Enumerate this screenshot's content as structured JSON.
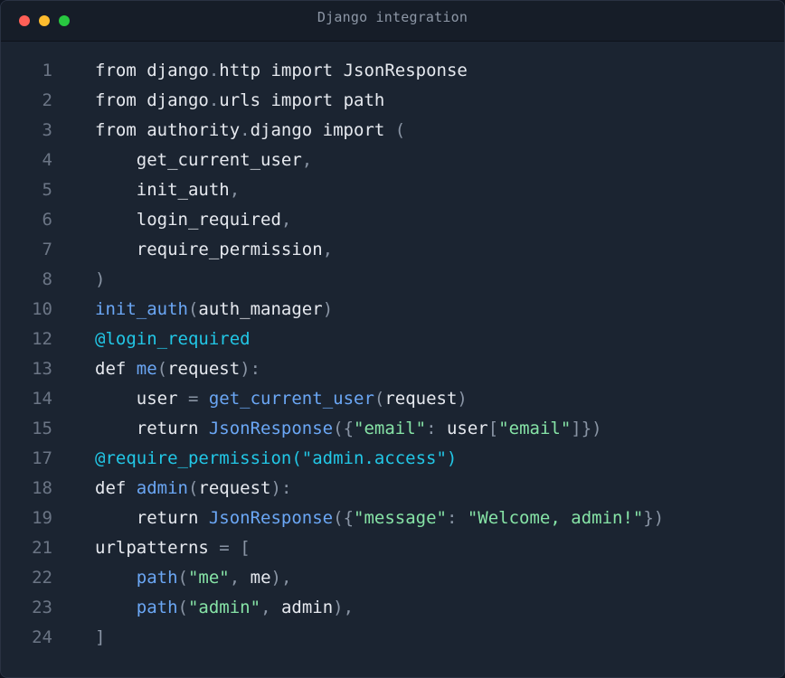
{
  "window": {
    "title": "Django integration"
  },
  "colors": {
    "background": "#1b2431",
    "titlebar": "#161d28",
    "plain": "#e6e9ef",
    "punct": "#8a95a5",
    "func": "#6ba7f5",
    "decorator": "#22c7e6",
    "string": "#86e3a6",
    "line_number": "#6b7585"
  },
  "code": {
    "lines": [
      {
        "n": "1",
        "tokens": [
          {
            "t": "from django",
            "c": "plain"
          },
          {
            "t": ".",
            "c": "punct"
          },
          {
            "t": "http import JsonResponse",
            "c": "plain"
          }
        ]
      },
      {
        "n": "2",
        "tokens": [
          {
            "t": "from django",
            "c": "plain"
          },
          {
            "t": ".",
            "c": "punct"
          },
          {
            "t": "urls import path",
            "c": "plain"
          }
        ]
      },
      {
        "n": "3",
        "tokens": [
          {
            "t": "from authority",
            "c": "plain"
          },
          {
            "t": ".",
            "c": "punct"
          },
          {
            "t": "django import ",
            "c": "plain"
          },
          {
            "t": "(",
            "c": "punct"
          }
        ]
      },
      {
        "n": "4",
        "tokens": [
          {
            "t": "    get_current_user",
            "c": "plain"
          },
          {
            "t": ",",
            "c": "punct"
          }
        ]
      },
      {
        "n": "5",
        "tokens": [
          {
            "t": "    init_auth",
            "c": "plain"
          },
          {
            "t": ",",
            "c": "punct"
          }
        ]
      },
      {
        "n": "6",
        "tokens": [
          {
            "t": "    login_required",
            "c": "plain"
          },
          {
            "t": ",",
            "c": "punct"
          }
        ]
      },
      {
        "n": "7",
        "tokens": [
          {
            "t": "    require_permission",
            "c": "plain"
          },
          {
            "t": ",",
            "c": "punct"
          }
        ]
      },
      {
        "n": "8",
        "tokens": [
          {
            "t": ")",
            "c": "punct"
          }
        ]
      },
      {
        "n": "10",
        "tokens": [
          {
            "t": "init_auth",
            "c": "func"
          },
          {
            "t": "(",
            "c": "punct"
          },
          {
            "t": "auth_manager",
            "c": "plain"
          },
          {
            "t": ")",
            "c": "punct"
          }
        ]
      },
      {
        "n": "12",
        "tokens": [
          {
            "t": "@login_required",
            "c": "deco"
          }
        ]
      },
      {
        "n": "13",
        "tokens": [
          {
            "t": "def ",
            "c": "plain"
          },
          {
            "t": "me",
            "c": "func"
          },
          {
            "t": "(",
            "c": "punct"
          },
          {
            "t": "request",
            "c": "plain"
          },
          {
            "t": "):",
            "c": "punct"
          }
        ]
      },
      {
        "n": "14",
        "tokens": [
          {
            "t": "    user ",
            "c": "plain"
          },
          {
            "t": "=",
            "c": "punct"
          },
          {
            "t": " ",
            "c": "plain"
          },
          {
            "t": "get_current_user",
            "c": "func"
          },
          {
            "t": "(",
            "c": "punct"
          },
          {
            "t": "request",
            "c": "plain"
          },
          {
            "t": ")",
            "c": "punct"
          }
        ]
      },
      {
        "n": "15",
        "tokens": [
          {
            "t": "    return ",
            "c": "plain"
          },
          {
            "t": "JsonResponse",
            "c": "func"
          },
          {
            "t": "({",
            "c": "punct"
          },
          {
            "t": "\"email\"",
            "c": "str"
          },
          {
            "t": ": ",
            "c": "punct"
          },
          {
            "t": "user",
            "c": "plain"
          },
          {
            "t": "[",
            "c": "punct"
          },
          {
            "t": "\"email\"",
            "c": "str"
          },
          {
            "t": "]})",
            "c": "punct"
          }
        ]
      },
      {
        "n": "17",
        "tokens": [
          {
            "t": "@require_permission(\"admin.access\")",
            "c": "deco"
          }
        ]
      },
      {
        "n": "18",
        "tokens": [
          {
            "t": "def ",
            "c": "plain"
          },
          {
            "t": "admin",
            "c": "func"
          },
          {
            "t": "(",
            "c": "punct"
          },
          {
            "t": "request",
            "c": "plain"
          },
          {
            "t": "):",
            "c": "punct"
          }
        ]
      },
      {
        "n": "19",
        "tokens": [
          {
            "t": "    return ",
            "c": "plain"
          },
          {
            "t": "JsonResponse",
            "c": "func"
          },
          {
            "t": "({",
            "c": "punct"
          },
          {
            "t": "\"message\"",
            "c": "str"
          },
          {
            "t": ": ",
            "c": "punct"
          },
          {
            "t": "\"Welcome, admin!\"",
            "c": "str"
          },
          {
            "t": "})",
            "c": "punct"
          }
        ]
      },
      {
        "n": "21",
        "tokens": [
          {
            "t": "urlpatterns ",
            "c": "plain"
          },
          {
            "t": "=",
            "c": "punct"
          },
          {
            "t": " ",
            "c": "plain"
          },
          {
            "t": "[",
            "c": "punct"
          }
        ]
      },
      {
        "n": "22",
        "tokens": [
          {
            "t": "    ",
            "c": "plain"
          },
          {
            "t": "path",
            "c": "func"
          },
          {
            "t": "(",
            "c": "punct"
          },
          {
            "t": "\"me\"",
            "c": "str"
          },
          {
            "t": ", ",
            "c": "punct"
          },
          {
            "t": "me",
            "c": "plain"
          },
          {
            "t": "),",
            "c": "punct"
          }
        ]
      },
      {
        "n": "23",
        "tokens": [
          {
            "t": "    ",
            "c": "plain"
          },
          {
            "t": "path",
            "c": "func"
          },
          {
            "t": "(",
            "c": "punct"
          },
          {
            "t": "\"admin\"",
            "c": "str"
          },
          {
            "t": ", ",
            "c": "punct"
          },
          {
            "t": "admin",
            "c": "plain"
          },
          {
            "t": "),",
            "c": "punct"
          }
        ]
      },
      {
        "n": "24",
        "tokens": [
          {
            "t": "]",
            "c": "punct"
          }
        ]
      }
    ]
  }
}
